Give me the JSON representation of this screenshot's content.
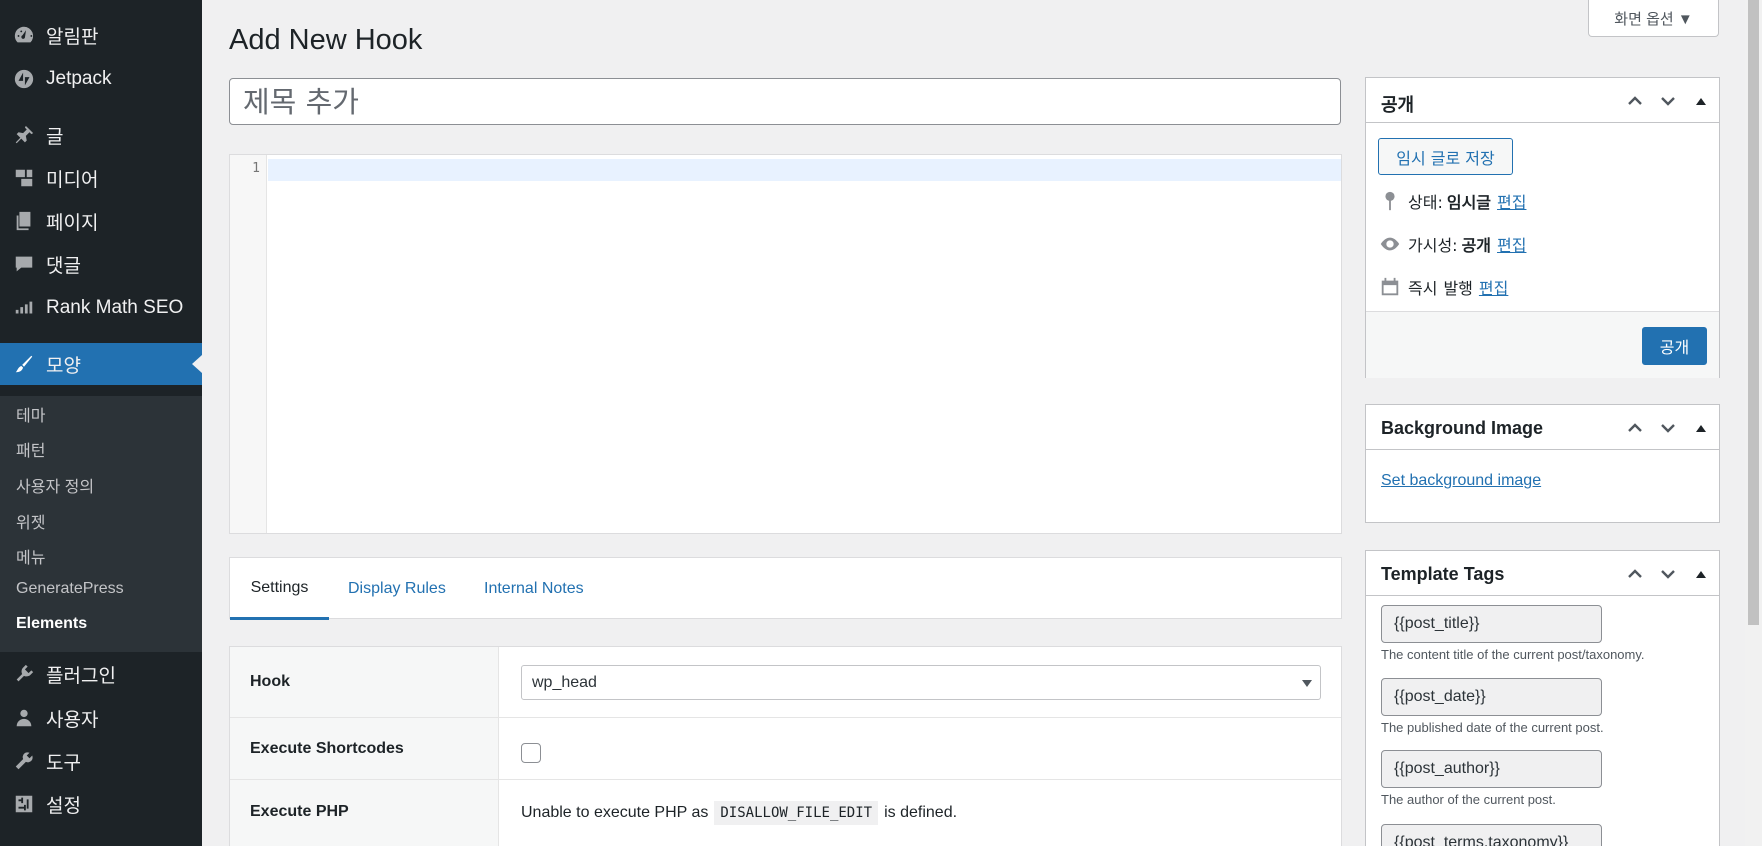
{
  "sidebar": {
    "items": [
      {
        "label": "알림판",
        "icon": "dashboard-icon"
      },
      {
        "label": "Jetpack",
        "icon": "jetpack-icon"
      },
      {
        "label": "글",
        "icon": "pin-icon"
      },
      {
        "label": "미디어",
        "icon": "media-icon"
      },
      {
        "label": "페이지",
        "icon": "pages-icon"
      },
      {
        "label": "댓글",
        "icon": "comments-icon"
      },
      {
        "label": "Rank Math SEO",
        "icon": "rank-math-icon"
      },
      {
        "label": "모양",
        "icon": "appearance-icon",
        "active": true
      },
      {
        "label": "플러그인",
        "icon": "plugins-icon"
      },
      {
        "label": "사용자",
        "icon": "users-icon"
      },
      {
        "label": "도구",
        "icon": "tools-icon"
      },
      {
        "label": "설정",
        "icon": "settings-icon"
      }
    ],
    "submenu": [
      "테마",
      "패턴",
      "사용자 정의",
      "위젯",
      "메뉴",
      "GeneratePress",
      "Elements"
    ],
    "submenu_current": "Elements",
    "active_color": "#2271b1"
  },
  "header": {
    "title": "Add New Hook",
    "screen_options": "화면 옵션 ▼"
  },
  "editor": {
    "title_placeholder": "제목 추가",
    "line_numbers": [
      "1"
    ]
  },
  "tabs": [
    "Settings",
    "Display Rules",
    "Internal Notes"
  ],
  "settings": {
    "hook_label": "Hook",
    "hook_value": "wp_head",
    "shortcodes_label": "Execute Shortcodes",
    "shortcodes_checked": false,
    "php_label": "Execute PHP",
    "php_text_before": "Unable to execute PHP as",
    "php_constant": "DISALLOW_FILE_EDIT",
    "php_text_after": "is defined."
  },
  "publish": {
    "title": "공개",
    "save_draft": "임시 글로 저장",
    "status_label": "상태:",
    "status_value": "임시글",
    "visibility_label": "가시성:",
    "visibility_value": "공개",
    "schedule_label": "즉시",
    "schedule_value": "발행",
    "edit_link": "편집",
    "publish_button": "공개"
  },
  "background_image": {
    "title": "Background Image",
    "link": "Set background image"
  },
  "template_tags": {
    "title": "Template Tags",
    "tags": [
      {
        "tag": "{{post_title}}",
        "desc": "The content title of the current post/taxonomy."
      },
      {
        "tag": "{{post_date}}",
        "desc": "The published date of the current post."
      },
      {
        "tag": "{{post_author}}",
        "desc": "The author of the current post."
      },
      {
        "tag": "{{post_terms.taxonomy}}",
        "desc": ""
      }
    ]
  }
}
